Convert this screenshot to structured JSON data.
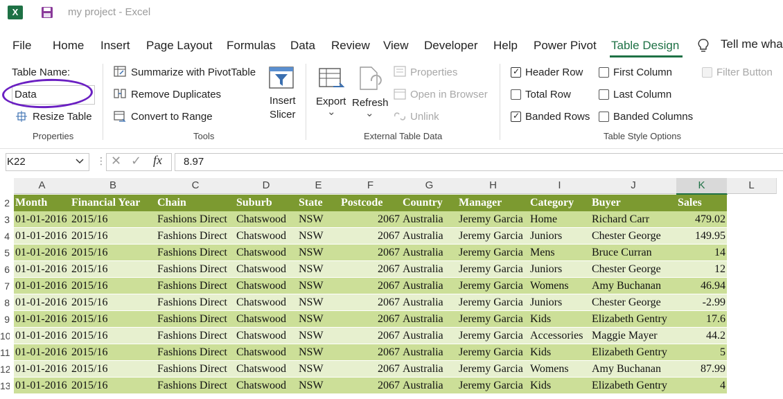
{
  "titlebar": {
    "logo": "X",
    "save_icon": "save-icon",
    "title": "my project  -  Excel"
  },
  "menu": [
    {
      "label": "File"
    },
    {
      "label": "Home"
    },
    {
      "label": "Insert"
    },
    {
      "label": "Page Layout"
    },
    {
      "label": "Formulas"
    },
    {
      "label": "Data"
    },
    {
      "label": "Review"
    },
    {
      "label": "View"
    },
    {
      "label": "Developer"
    },
    {
      "label": "Help"
    },
    {
      "label": "Power Pivot"
    },
    {
      "label": "Table Design",
      "active": true
    }
  ],
  "tell_me": {
    "icon": "lightbulb-icon",
    "label": "Tell me wha"
  },
  "ribbon": {
    "properties": {
      "table_name_label": "Table Name:",
      "table_name_value": "Data",
      "resize_label": "Resize Table",
      "group_label": "Properties"
    },
    "tools": {
      "summarize": "Summarize with PivotTable",
      "remove_duplicates": "Remove Duplicates",
      "convert": "Convert to Range",
      "insert_slicer_1": "Insert",
      "insert_slicer_2": "Slicer",
      "group_label": "Tools"
    },
    "external": {
      "export": "Export",
      "refresh": "Refresh",
      "chevron": "⌄",
      "properties": "Properties",
      "open_browser": "Open in Browser",
      "unlink": "Unlink",
      "group_label": "External Table Data"
    },
    "style_options": {
      "header_row": "Header Row",
      "total_row": "Total Row",
      "banded_rows": "Banded Rows",
      "first_column": "First Column",
      "last_column": "Last Column",
      "banded_columns": "Banded Columns",
      "filter_button": "Filter Button",
      "group_label": "Table Style Options",
      "checked": {
        "header_row": true,
        "total_row": false,
        "banded_rows": true,
        "first_column": false,
        "last_column": false,
        "banded_columns": false,
        "filter_button": false
      }
    }
  },
  "formula_bar": {
    "cell_ref": "K22",
    "formula": "8.97",
    "fx": "fx",
    "cancel": "✕",
    "enter": "✓"
  },
  "colors": {
    "header_green": "#7c9a30",
    "band_dark": "#ccdf98",
    "band_light": "#e7f0cf",
    "accent": "#1e7145",
    "circle": "#6a1fc2"
  },
  "grid": {
    "columns": [
      "A",
      "B",
      "C",
      "D",
      "E",
      "F",
      "G",
      "H",
      "I",
      "J",
      "K",
      "L"
    ],
    "headers": [
      "Month",
      "Financial Year",
      "Chain",
      "Suburb",
      "State",
      "Postcode",
      "Country",
      "Manager",
      "Category",
      "Buyer",
      "Sales"
    ],
    "row_numbers": [
      "2",
      "3",
      "4",
      "5",
      "6",
      "7",
      "8",
      "9",
      "10",
      "11",
      "12",
      "13"
    ],
    "rows": [
      [
        "01-01-2016",
        "2015/16",
        "Fashions Direct",
        "Chatswood",
        "NSW",
        "2067",
        "Australia",
        "Jeremy Garcia",
        "Home",
        "Richard Carr",
        "479.02"
      ],
      [
        "01-01-2016",
        "2015/16",
        "Fashions Direct",
        "Chatswood",
        "NSW",
        "2067",
        "Australia",
        "Jeremy Garcia",
        "Juniors",
        "Chester George",
        "149.95"
      ],
      [
        "01-01-2016",
        "2015/16",
        "Fashions Direct",
        "Chatswood",
        "NSW",
        "2067",
        "Australia",
        "Jeremy Garcia",
        "Mens",
        "Bruce Curran",
        "14"
      ],
      [
        "01-01-2016",
        "2015/16",
        "Fashions Direct",
        "Chatswood",
        "NSW",
        "2067",
        "Australia",
        "Jeremy Garcia",
        "Juniors",
        "Chester George",
        "12"
      ],
      [
        "01-01-2016",
        "2015/16",
        "Fashions Direct",
        "Chatswood",
        "NSW",
        "2067",
        "Australia",
        "Jeremy Garcia",
        "Womens",
        "Amy Buchanan",
        "46.94"
      ],
      [
        "01-01-2016",
        "2015/16",
        "Fashions Direct",
        "Chatswood",
        "NSW",
        "2067",
        "Australia",
        "Jeremy Garcia",
        "Juniors",
        "Chester George",
        "-2.99"
      ],
      [
        "01-01-2016",
        "2015/16",
        "Fashions Direct",
        "Chatswood",
        "NSW",
        "2067",
        "Australia",
        "Jeremy Garcia",
        "Kids",
        "Elizabeth Gentry",
        "17.6"
      ],
      [
        "01-01-2016",
        "2015/16",
        "Fashions Direct",
        "Chatswood",
        "NSW",
        "2067",
        "Australia",
        "Jeremy Garcia",
        "Accessories",
        "Maggie Mayer",
        "44.2"
      ],
      [
        "01-01-2016",
        "2015/16",
        "Fashions Direct",
        "Chatswood",
        "NSW",
        "2067",
        "Australia",
        "Jeremy Garcia",
        "Kids",
        "Elizabeth Gentry",
        "5"
      ],
      [
        "01-01-2016",
        "2015/16",
        "Fashions Direct",
        "Chatswood",
        "NSW",
        "2067",
        "Australia",
        "Jeremy Garcia",
        "Womens",
        "Amy Buchanan",
        "87.99"
      ],
      [
        "01-01-2016",
        "2015/16",
        "Fashions Direct",
        "Chatswood",
        "NSW",
        "2067",
        "Australia",
        "Jeremy Garcia",
        "Kids",
        "Elizabeth Gentry",
        "4"
      ]
    ]
  }
}
